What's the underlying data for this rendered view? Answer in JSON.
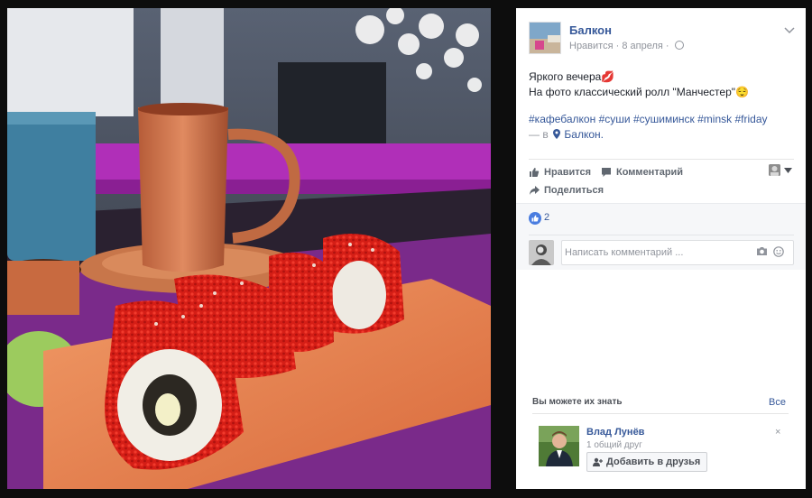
{
  "post": {
    "page_name": "Балкон",
    "like_page": "Нравится",
    "date_separator": "·",
    "date": "8 апреля",
    "text_line1": "Яркого вечера💋",
    "text_line2": "На фото классический ролл \"Манчестер\"😌",
    "hashtags": [
      "#кафебалкон",
      "#суши",
      "#сушиминск",
      "#minsk",
      "#friday"
    ],
    "location_prefix": "— в",
    "location": "Балкон."
  },
  "actions": {
    "like": "Нравится",
    "comment": "Комментарий",
    "share": "Поделиться"
  },
  "reactions": {
    "like_count": "2"
  },
  "comment_box": {
    "placeholder": "Написать комментарий ..."
  },
  "suggestions": {
    "title": "Вы можете их знать",
    "see_all": "Все",
    "dismiss": "×",
    "person": {
      "name": "Влад Лунёв",
      "mutual": "1 общий друг",
      "add_button": "Добавить в друзья"
    }
  },
  "colors": {
    "link": "#365899",
    "like_blue": "#4a7de0",
    "bar_magenta": "#b02fb8",
    "plate_orange": "#e27a4a"
  },
  "icons": [
    "thumbs-up-icon",
    "comment-icon",
    "share-icon",
    "globe-icon",
    "chevron-down-icon",
    "camera-icon",
    "emoji-icon",
    "add-friend-icon"
  ]
}
